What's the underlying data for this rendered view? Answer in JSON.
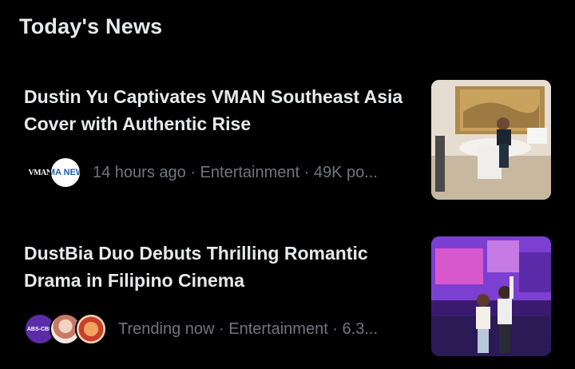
{
  "section": {
    "title": "Today's News"
  },
  "stories": [
    {
      "headline": "Dustin Yu Captivates VMAN Southeast Asia Cover with Authentic Rise",
      "time": "14 hours ago",
      "category": "Entertainment",
      "posts": "49K po...",
      "avatars": [
        "VMAN",
        "GMA NEWS"
      ],
      "thumbnail_icon": "office-portrait-image"
    },
    {
      "headline": "DustBia Duo Debuts Thrilling Romantic Drama in Filipino Cinema",
      "time": "Trending now",
      "category": "Entertainment",
      "posts": "6.3...",
      "avatars": [
        "ABS-CBN",
        "",
        ""
      ],
      "thumbnail_icon": "stage-duo-image"
    }
  ],
  "separator": " · ",
  "colors": {
    "background": "#000000",
    "text": "#e7e9ea",
    "muted": "#71767b"
  }
}
